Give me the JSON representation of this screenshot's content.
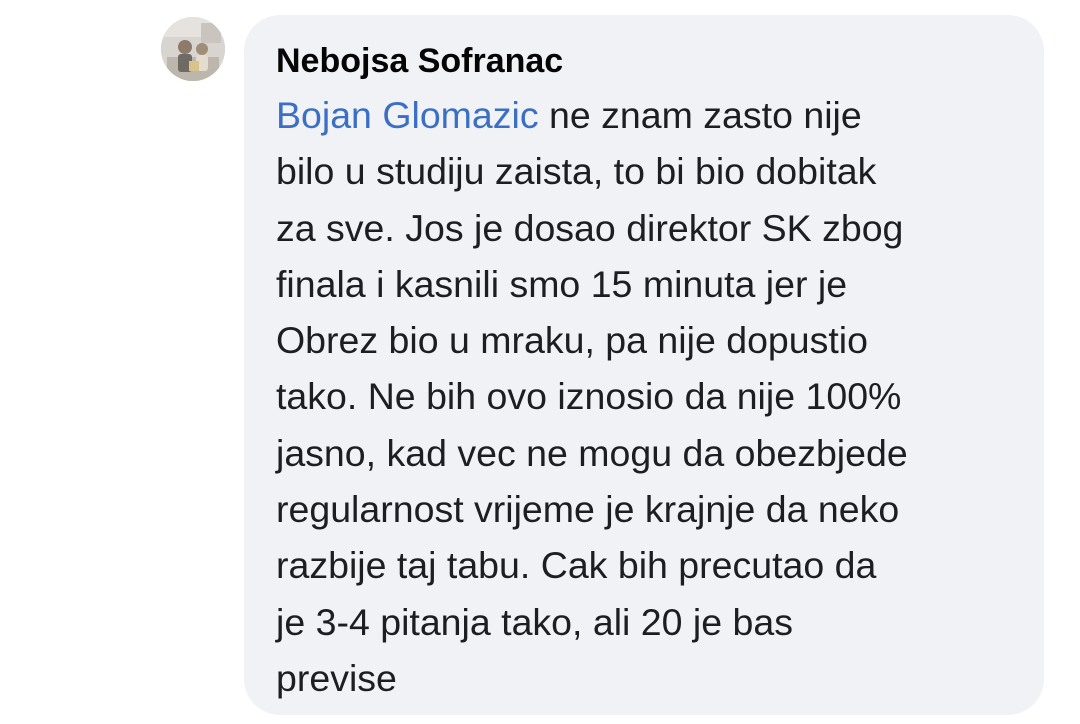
{
  "comment": {
    "author": "Nebojsa Sofranac",
    "avatar": "profile-photo",
    "mention": "Bojan Glomazic",
    "text_lines": [
      " ne znam zasto nije",
      "bilo u studiju zaista, to bi bio dobitak",
      "za sve. Jos je dosao direktor SK zbog",
      "finala i kasnili smo 15 minuta jer je",
      "Obrez bio u mraku, pa nije dopustio",
      "tako. Ne bih ovo iznosio da nije 100%",
      "jasno, kad vec ne mogu da obezbjede",
      "regularnost vrijeme je krajnje da neko",
      "razbije taj tabu. Cak bih precutao da",
      "je 3-4 pitanja tako, ali 20 je bas",
      "previse"
    ],
    "colors": {
      "bubble": "#f0f2f5",
      "mention": "#3b6fc5",
      "text": "#1c1e21"
    }
  }
}
